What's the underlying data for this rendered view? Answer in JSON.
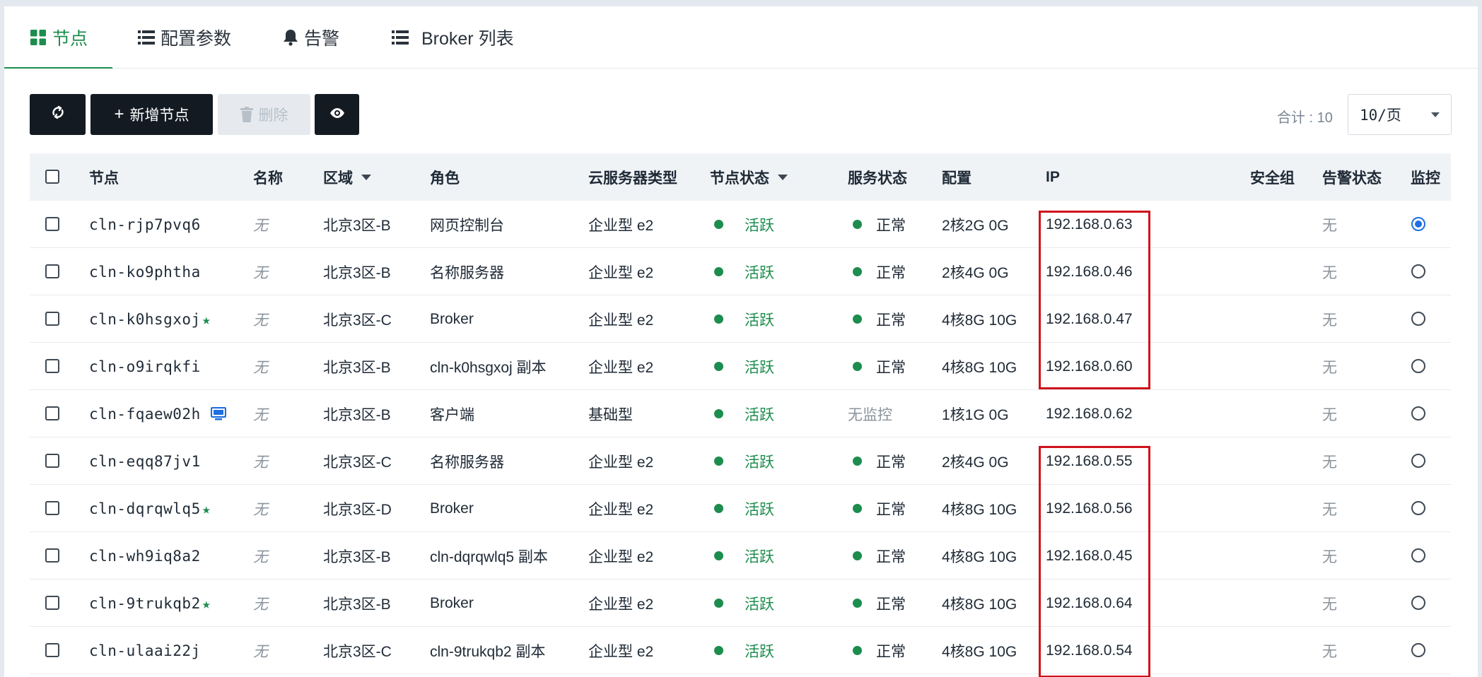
{
  "tabs": [
    {
      "label": "节点",
      "icon": "grid-icon",
      "active": true
    },
    {
      "label": "配置参数",
      "icon": "list-icon",
      "active": false
    },
    {
      "label": "告警",
      "icon": "bell-icon",
      "active": false
    },
    {
      "label": "Broker 列表",
      "icon": "list-icon",
      "active": false
    }
  ],
  "toolbar": {
    "refresh_icon": "refresh-icon",
    "add_label": "新增节点",
    "delete_label": "删除",
    "eye_icon": "eye-icon",
    "total_label": "合计 : 10",
    "page_size": "10/页"
  },
  "table": {
    "headers": {
      "node": "节点",
      "name": "名称",
      "region": "区域",
      "role": "角色",
      "server_type": "云服务器类型",
      "node_status": "节点状态",
      "service_status": "服务状态",
      "config": "配置",
      "ip": "IP",
      "security_group": "安全组",
      "alert_status": "告警状态",
      "monitor": "监控"
    },
    "rows": [
      {
        "node": "cln-rjp7pvq6",
        "marker": "",
        "name": "无",
        "region": "北京3区-B",
        "role": "网页控制台",
        "server_type": "企业型 e2",
        "node_status": "活跃",
        "service_status": "正常",
        "service_dot": true,
        "config": "2核2G 0G",
        "ip": "192.168.0.63",
        "alert_status": "无",
        "monitor_checked": true
      },
      {
        "node": "cln-ko9phtha",
        "marker": "",
        "name": "无",
        "region": "北京3区-B",
        "role": "名称服务器",
        "server_type": "企业型 e2",
        "node_status": "活跃",
        "service_status": "正常",
        "service_dot": true,
        "config": "2核4G 0G",
        "ip": "192.168.0.46",
        "alert_status": "无",
        "monitor_checked": false
      },
      {
        "node": "cln-k0hsgxoj",
        "marker": "star",
        "name": "无",
        "region": "北京3区-C",
        "role": "Broker",
        "server_type": "企业型 e2",
        "node_status": "活跃",
        "service_status": "正常",
        "service_dot": true,
        "config": "4核8G 10G",
        "ip": "192.168.0.47",
        "alert_status": "无",
        "monitor_checked": false
      },
      {
        "node": "cln-o9irqkfi",
        "marker": "",
        "name": "无",
        "region": "北京3区-B",
        "role": "cln-k0hsgxoj 副本",
        "server_type": "企业型 e2",
        "node_status": "活跃",
        "service_status": "正常",
        "service_dot": true,
        "config": "4核8G 10G",
        "ip": "192.168.0.60",
        "alert_status": "无",
        "monitor_checked": false
      },
      {
        "node": "cln-fqaew02h",
        "marker": "monitor",
        "name": "无",
        "region": "北京3区-B",
        "role": "客户端",
        "server_type": "基础型",
        "node_status": "活跃",
        "service_status": "无监控",
        "service_dot": false,
        "config": "1核1G 0G",
        "ip": "192.168.0.62",
        "alert_status": "无",
        "monitor_checked": false
      },
      {
        "node": "cln-eqq87jv1",
        "marker": "",
        "name": "无",
        "region": "北京3区-C",
        "role": "名称服务器",
        "server_type": "企业型 e2",
        "node_status": "活跃",
        "service_status": "正常",
        "service_dot": true,
        "config": "2核4G 0G",
        "ip": "192.168.0.55",
        "alert_status": "无",
        "monitor_checked": false
      },
      {
        "node": "cln-dqrqwlq5",
        "marker": "star",
        "name": "无",
        "region": "北京3区-D",
        "role": "Broker",
        "server_type": "企业型 e2",
        "node_status": "活跃",
        "service_status": "正常",
        "service_dot": true,
        "config": "4核8G 10G",
        "ip": "192.168.0.56",
        "alert_status": "无",
        "monitor_checked": false
      },
      {
        "node": "cln-wh9iq8a2",
        "marker": "",
        "name": "无",
        "region": "北京3区-B",
        "role": "cln-dqrqwlq5 副本",
        "server_type": "企业型 e2",
        "node_status": "活跃",
        "service_status": "正常",
        "service_dot": true,
        "config": "4核8G 10G",
        "ip": "192.168.0.45",
        "alert_status": "无",
        "monitor_checked": false
      },
      {
        "node": "cln-9trukqb2",
        "marker": "star",
        "name": "无",
        "region": "北京3区-B",
        "role": "Broker",
        "server_type": "企业型 e2",
        "node_status": "活跃",
        "service_status": "正常",
        "service_dot": true,
        "config": "4核8G 10G",
        "ip": "192.168.0.64",
        "alert_status": "无",
        "monitor_checked": false
      },
      {
        "node": "cln-ulaai22j",
        "marker": "",
        "name": "无",
        "region": "北京3区-C",
        "role": "cln-9trukqb2 副本",
        "server_type": "企业型 e2",
        "node_status": "活跃",
        "service_status": "正常",
        "service_dot": true,
        "config": "4核8G 10G",
        "ip": "192.168.0.54",
        "alert_status": "无",
        "monitor_checked": false
      }
    ]
  },
  "colors": {
    "accent": "#1c8d4e",
    "highlight": "#d0121b",
    "radio_selected": "#1e6fe0"
  }
}
